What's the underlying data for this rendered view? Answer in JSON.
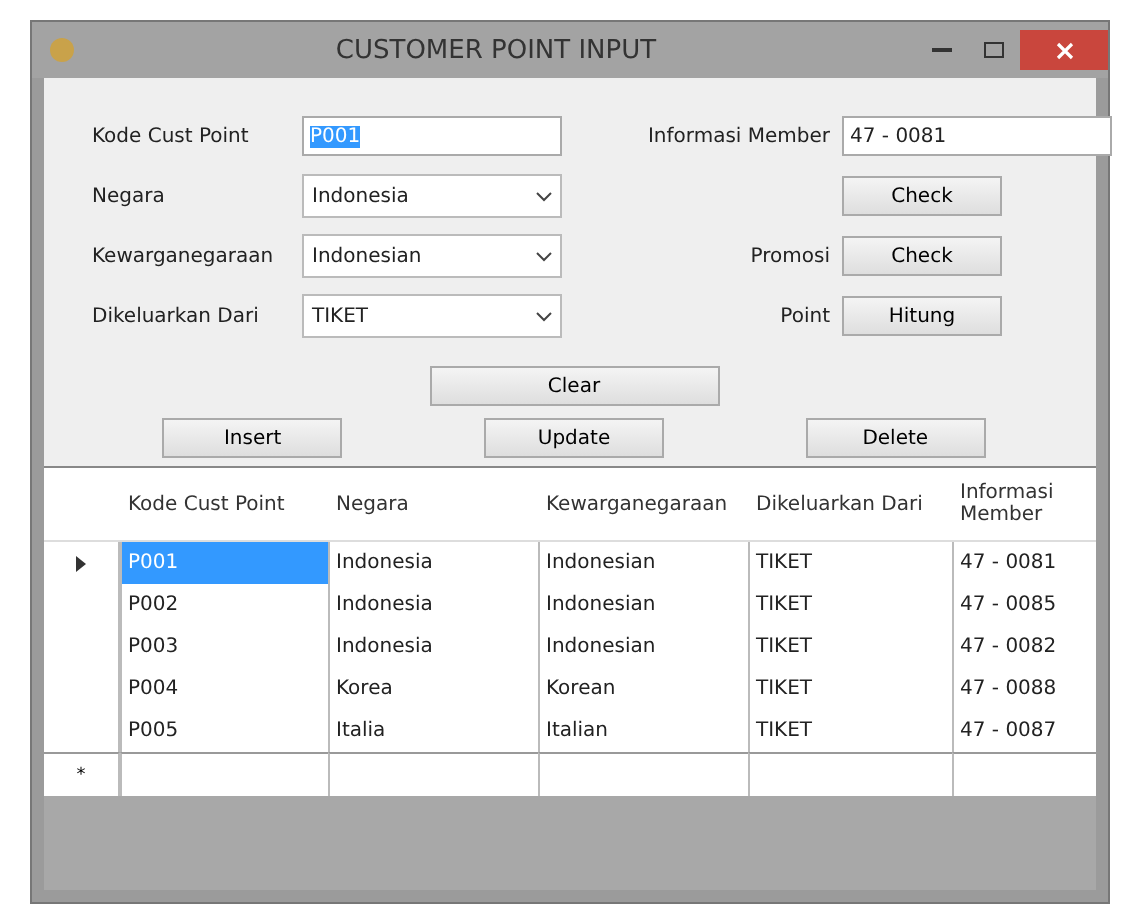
{
  "window": {
    "title": "CUSTOMER POINT INPUT"
  },
  "form": {
    "fields": [
      {
        "label": "Kode Cust Point",
        "kind": "text",
        "value": "P001",
        "selected": true
      },
      {
        "label": "Negara",
        "kind": "combo",
        "value": "Indonesia",
        "selected": false
      },
      {
        "label": "Kewarganegaraan",
        "kind": "combo",
        "value": "Indonesian",
        "selected": false
      },
      {
        "label": "Dikeluarkan Dari",
        "kind": "combo",
        "value": "TIKET",
        "selected": false
      }
    ],
    "member": {
      "label": "Informasi Member",
      "value": "47 - 0081",
      "button": "Check"
    },
    "promo": {
      "label": "Promosi",
      "button": "Check"
    },
    "point": {
      "label": "Point",
      "button": "Hitung"
    },
    "clear_button": "Clear",
    "actions": [
      "Insert",
      "Update",
      "Delete"
    ]
  },
  "table": {
    "columns": [
      "Kode Cust Point",
      "Negara",
      "Kewarganegaraan",
      "Dikeluarkan Dari",
      "Informasi Member"
    ],
    "rows": [
      {
        "cells": [
          "P001",
          "Indonesia",
          "Indonesian",
          "TIKET",
          "47 - 0081"
        ],
        "selected": true
      },
      {
        "cells": [
          "P002",
          "Indonesia",
          "Indonesian",
          "TIKET",
          "47 - 0085"
        ],
        "selected": false
      },
      {
        "cells": [
          "P003",
          "Indonesia",
          "Indonesian",
          "TIKET",
          "47 - 0082"
        ],
        "selected": false
      },
      {
        "cells": [
          "P004",
          "Korea",
          "Korean",
          "TIKET",
          "47 - 0088"
        ],
        "selected": false
      },
      {
        "cells": [
          "P005",
          "Italia",
          "Italian",
          "TIKET",
          "47 - 0087"
        ],
        "selected": false
      }
    ],
    "new_row_marker": "*"
  }
}
